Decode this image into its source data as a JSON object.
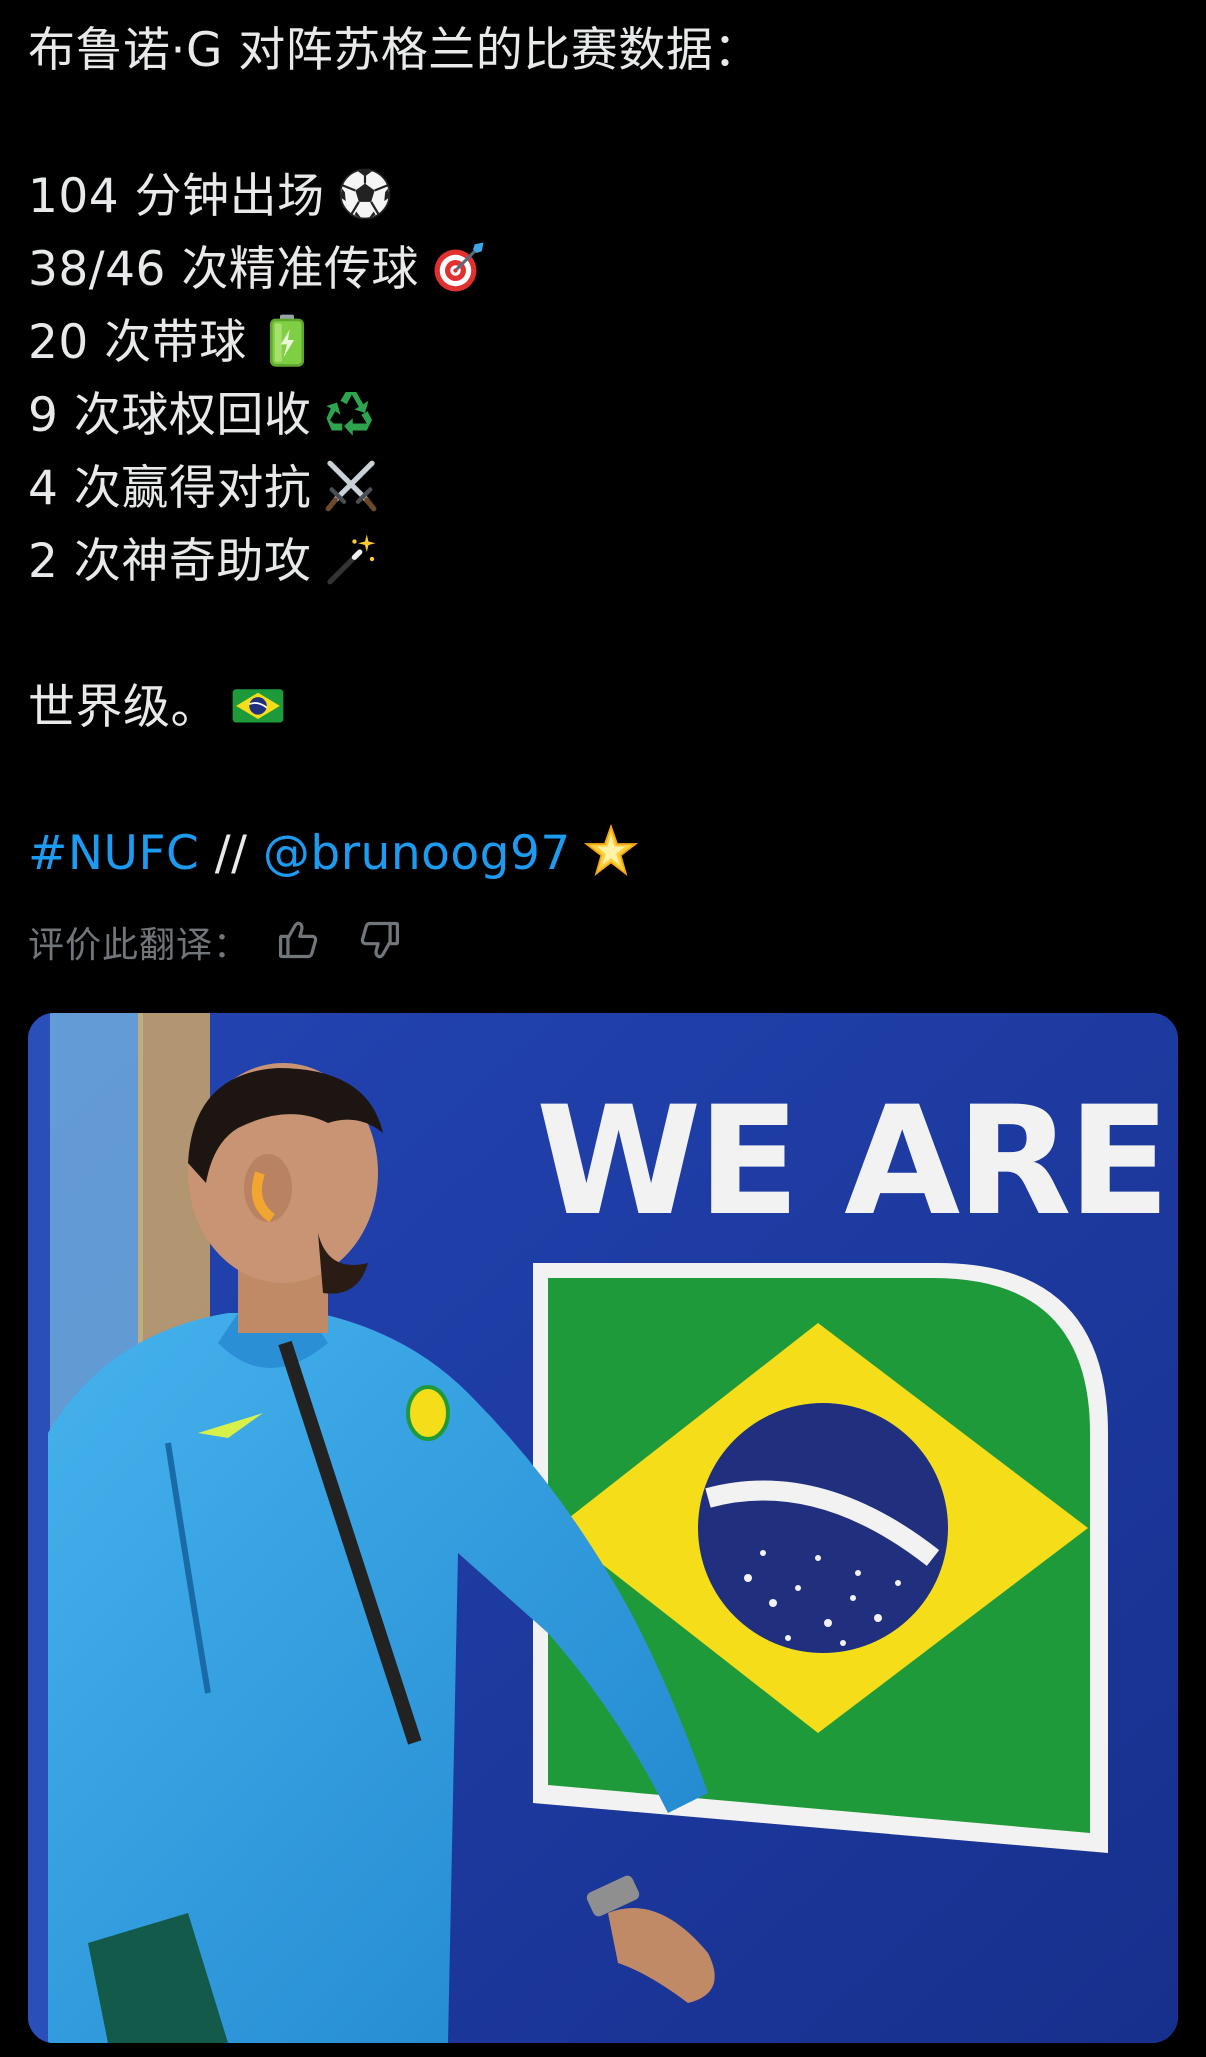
{
  "tweet": {
    "title_line": "布鲁诺·G 对阵苏格兰的比赛数据：",
    "stats": [
      {
        "text": "104 分钟出场",
        "icon": "soccer-ball-icon"
      },
      {
        "text": "38/46 次精准传球",
        "icon": "target-dart-icon"
      },
      {
        "text": "20 次带球",
        "icon": "battery-icon"
      },
      {
        "text": "9 次球权回收",
        "icon": "recycle-icon"
      },
      {
        "text": "4 次赢得对抗",
        "icon": "crossed-swords-icon"
      },
      {
        "text": "2 次神奇助攻",
        "icon": "magic-wand-icon"
      }
    ],
    "summary_text": "世界级。",
    "summary_icon": "brazil-flag-icon",
    "hashtag": "#NUFC",
    "separator": "//",
    "mention": "@brunoog97",
    "mention_icon": "glowing-star-icon",
    "link_color": "#1d9bf0"
  },
  "translation_rating": {
    "label": "评价此翻译：",
    "thumbs_up_icon": "thumbs-up-icon",
    "thumbs_down_icon": "thumbs-down-icon"
  },
  "media": {
    "banner_text": "WE ARE",
    "banner_colors": {
      "background": "#1f3fa8",
      "green": "#1f9a3a",
      "yellow": "#f5dd1a",
      "globe": "#21307e",
      "jacket": "#2f9fe0"
    }
  }
}
